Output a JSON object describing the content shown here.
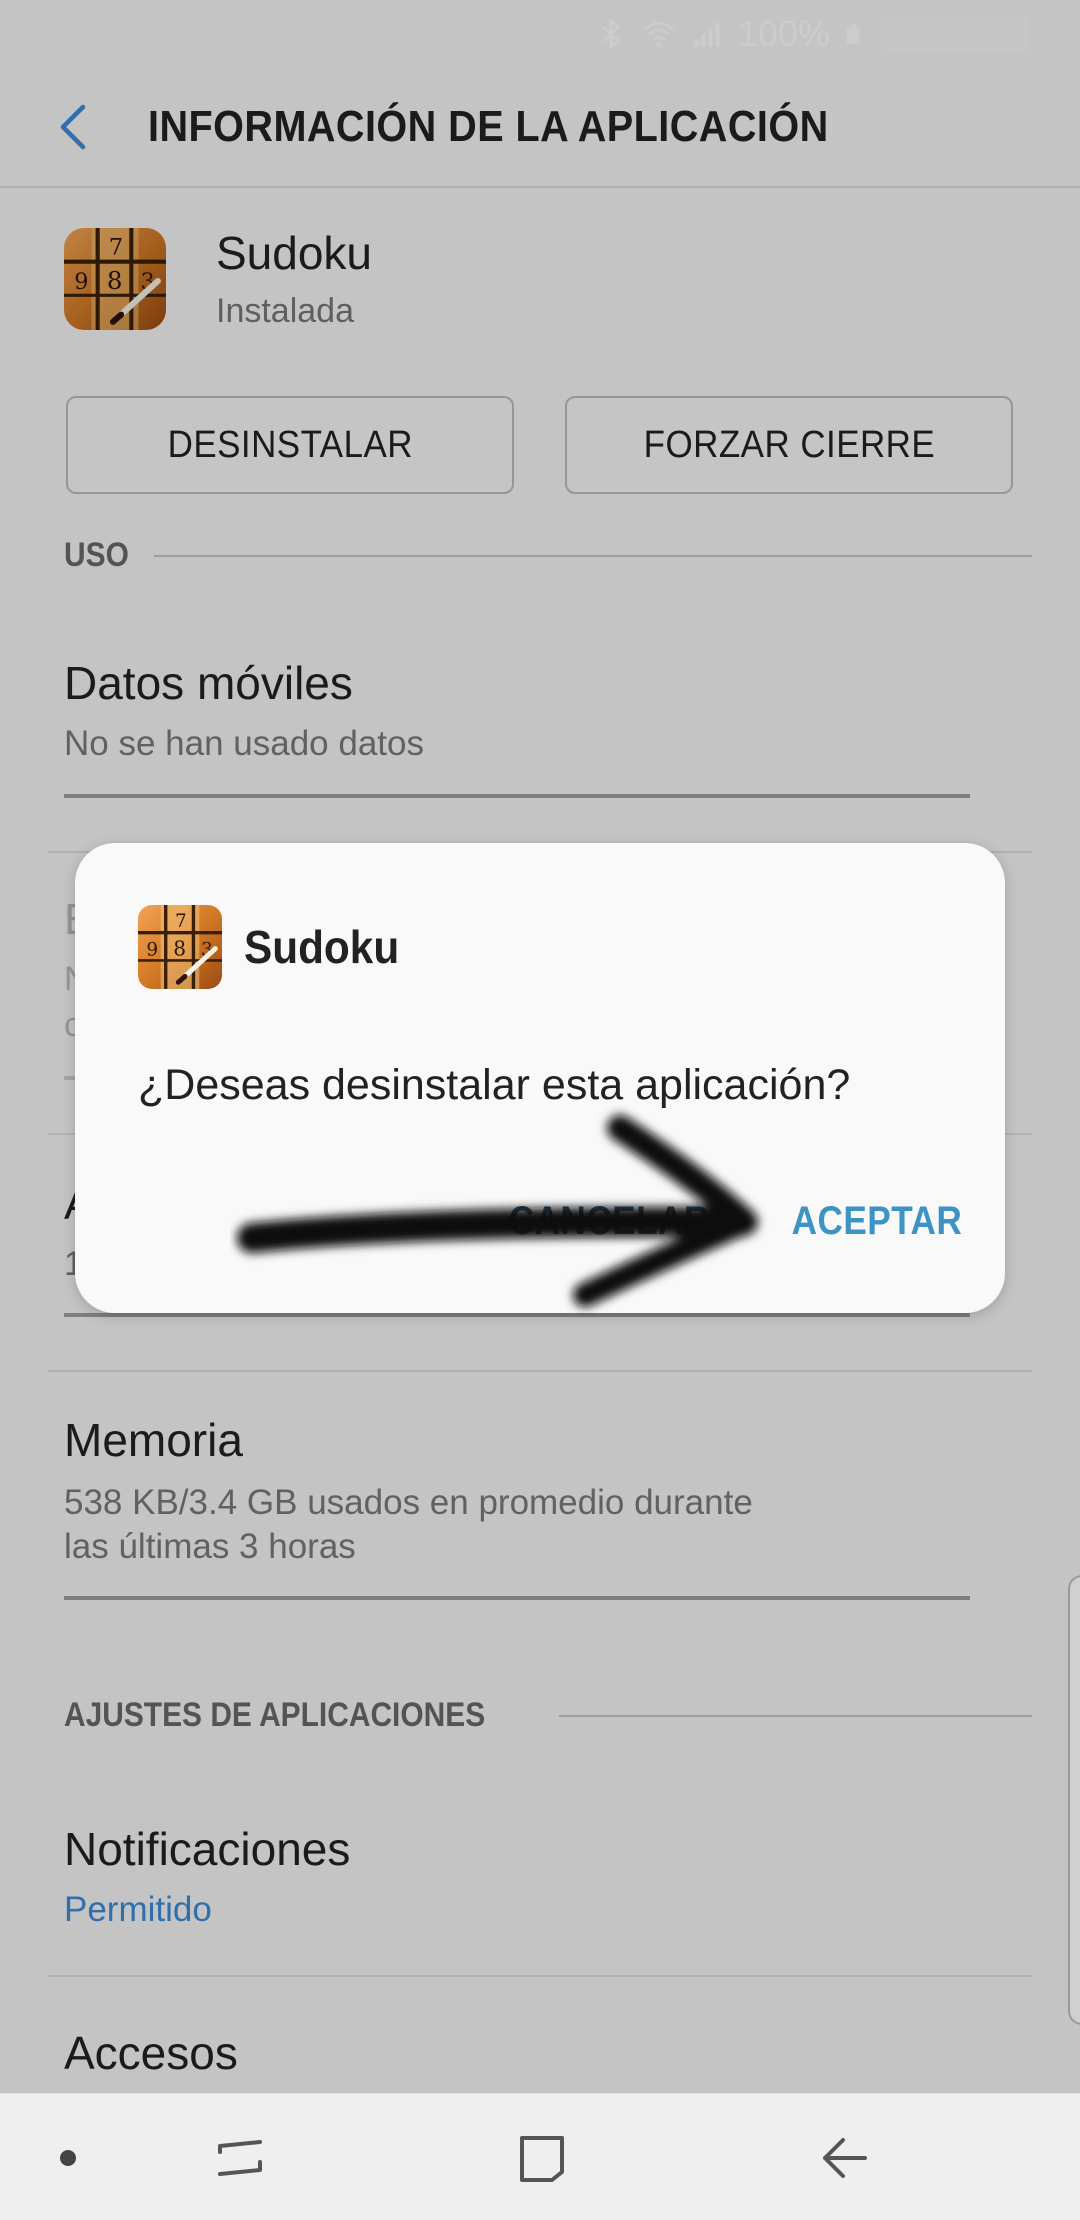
{
  "status_bar": {
    "battery_text": "100%"
  },
  "header": {
    "title": "INFORMACIÓN DE LA APLICACIÓN"
  },
  "app": {
    "name": "Sudoku",
    "status": "Instalada"
  },
  "actions": {
    "uninstall_label": "DESINSTALAR",
    "force_stop_label": "FORZAR CIERRE"
  },
  "sections": {
    "usage_header": "USO",
    "app_settings_header": "AJUSTES DE APLICACIONES"
  },
  "items": {
    "mobile_data": {
      "title": "Datos móviles",
      "subtitle": "No se han usado datos"
    },
    "partial_1": {
      "title": "E",
      "sub_a": "N",
      "sub_b": "c"
    },
    "partial_2": {
      "title": "A",
      "sub_a": "1"
    },
    "memory": {
      "title": "Memoria",
      "subtitle_1": "538 KB/3.4 GB usados en promedio durante",
      "subtitle_2": "las últimas 3 horas"
    },
    "notifications": {
      "title": "Notificaciones",
      "subtitle": "Permitido"
    },
    "permissions": {
      "title": "Accesos"
    }
  },
  "dialog": {
    "title": "Sudoku",
    "message": "¿Deseas desinstalar esta aplicación?",
    "cancel_label": "CANCELAR",
    "accept_label": "ACEPTAR"
  },
  "icons": {
    "back": "arrow-left-icon",
    "app": "sudoku-app-icon",
    "nav_dot": "dot-icon",
    "nav_recents": "recents-icon",
    "nav_home": "home-icon",
    "nav_back": "back-arrow-icon"
  },
  "colors": {
    "accent": "#3c93c4",
    "link_blue": "#3d8bd6",
    "dialog_bg": "#f9f9f9",
    "overlay": "rgba(0,0,0,0.2)"
  }
}
